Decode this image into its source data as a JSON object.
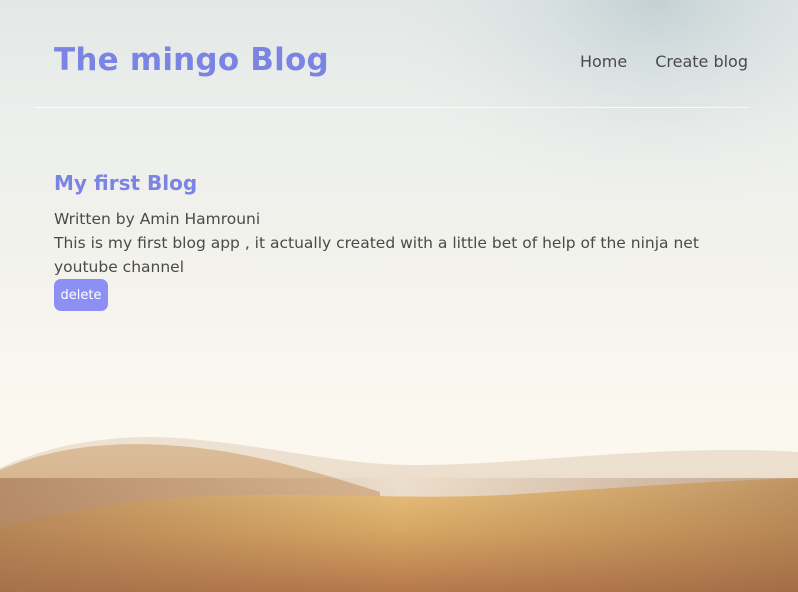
{
  "navbar": {
    "brand": "The mingo Blog",
    "links": [
      {
        "label": "Home"
      },
      {
        "label": "Create blog"
      }
    ]
  },
  "blog": {
    "title": "My first Blog",
    "author_line": "Written by Amin Hamrouni",
    "body": "This is my first blog app , it actually created with a little bet of help of the ninja net youtube channel",
    "delete_label": "delete"
  },
  "colors": {
    "accent": "#7b84e3",
    "button": "#8c90f4",
    "text": "#4a4a4a"
  }
}
